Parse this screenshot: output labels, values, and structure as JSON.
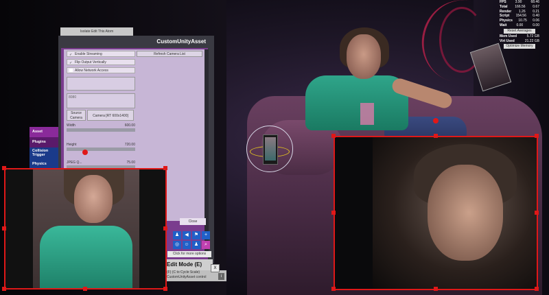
{
  "stats": [
    {
      "label": "FPS",
      "v1": "3.90",
      "v2": "68.46"
    },
    {
      "label": "Total",
      "v1": "166.56",
      "v2": "0.67"
    },
    {
      "label": "Render",
      "v1": "1.26",
      "v2": "0.21"
    },
    {
      "label": "Script",
      "v1": "154.56",
      "v2": "0.40"
    },
    {
      "label": "Physics",
      "v1": "10.75",
      "v2": "0.06"
    },
    {
      "label": "Wait",
      "v1": "0.00",
      "v2": "0.00"
    }
  ],
  "stats_buttons": {
    "reset": "Reset Averages",
    "optimize": "Optimize Memory"
  },
  "memory": [
    {
      "label": "Mem Used",
      "value": "5.72 GB"
    },
    {
      "label": "Virt Used",
      "value": "21.22 GB"
    }
  ],
  "panel": {
    "top_tab": "Isolate Edit This Atom",
    "title": "CustomUnityAsset",
    "enable_streaming": "Enable Streaming",
    "flip_output": "Flip Output Vertically",
    "allow_network": "Allow Network Access",
    "refresh_camera": "Refresh Camera List",
    "field_label": "8080",
    "source_camera_label": "Source Camera",
    "camera_value": "Camera [RT 600x1400]",
    "width_label": "Width",
    "width_value": "600.00",
    "height_label": "Height",
    "height_value": "720.00",
    "jpeg_label": "JPEG Q...",
    "jpeg_value": "75.00",
    "close": "Close"
  },
  "side_tabs": [
    "Asset",
    "Plugins",
    "Collision Trigger",
    "Physics"
  ],
  "toolbar": {
    "more_options": "Click for more options"
  },
  "edit_mode": {
    "title": "Edit Mode (E)",
    "hint_line1": "(F) (C to Cycle Scale)",
    "hint_line2": "CustomUnityAsset control",
    "close": "X",
    "info": "i"
  },
  "accent_colors": {
    "selection": "#e01818",
    "panel_purple": "#7a3c8e",
    "tool_blue": "#2060c8"
  }
}
